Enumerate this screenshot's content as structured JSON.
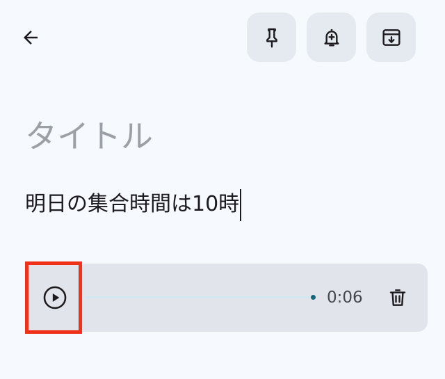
{
  "header": {
    "back_icon": "arrow-back-icon",
    "actions": [
      {
        "name": "pin",
        "icon": "pin-icon"
      },
      {
        "name": "reminder",
        "icon": "bell-plus-icon"
      },
      {
        "name": "archive",
        "icon": "archive-icon"
      }
    ]
  },
  "note": {
    "title_placeholder": "タイトル",
    "title_value": "",
    "body": "明日の集合時間は10時"
  },
  "audio": {
    "play_icon": "play-circle-icon",
    "duration": "0:06",
    "progress": 0,
    "delete_icon": "trash-icon"
  },
  "colors": {
    "background": "#f6f9fd",
    "action_button_bg": "#e5eaf0",
    "audio_card_bg": "#e1e4ea",
    "highlight": "#f0311a",
    "progress_dot": "#17657a"
  }
}
